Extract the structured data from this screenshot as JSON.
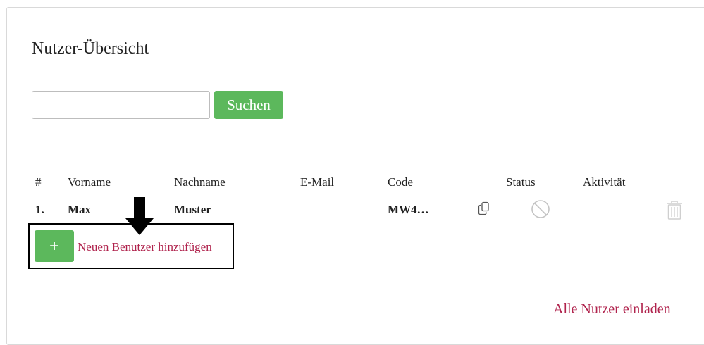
{
  "page": {
    "title": "Nutzer-Übersicht"
  },
  "search": {
    "value": "",
    "button_label": "Suchen"
  },
  "table": {
    "headers": [
      "#",
      "Vorname",
      "Nachname",
      "E-Mail",
      "Code",
      "Status",
      "Aktivität"
    ],
    "rows": [
      {
        "index": "1.",
        "first_name": "Max",
        "last_name": "Muster",
        "email": "",
        "code": "MW4…",
        "icons": [
          "copy-icon",
          "blocked-status-icon",
          "trash-icon"
        ]
      }
    ]
  },
  "actions": {
    "add_button_symbol": "+",
    "add_user_label": "Neuen Benutzer hinzufügen",
    "invite_all_label": "Alle Nutzer einladen"
  },
  "annotation": {
    "arrow_icon": "down-arrow-icon",
    "highlight_color": "#000000"
  },
  "colors": {
    "accent_green": "#5cb85c",
    "link_crimson": "#b0234d"
  }
}
